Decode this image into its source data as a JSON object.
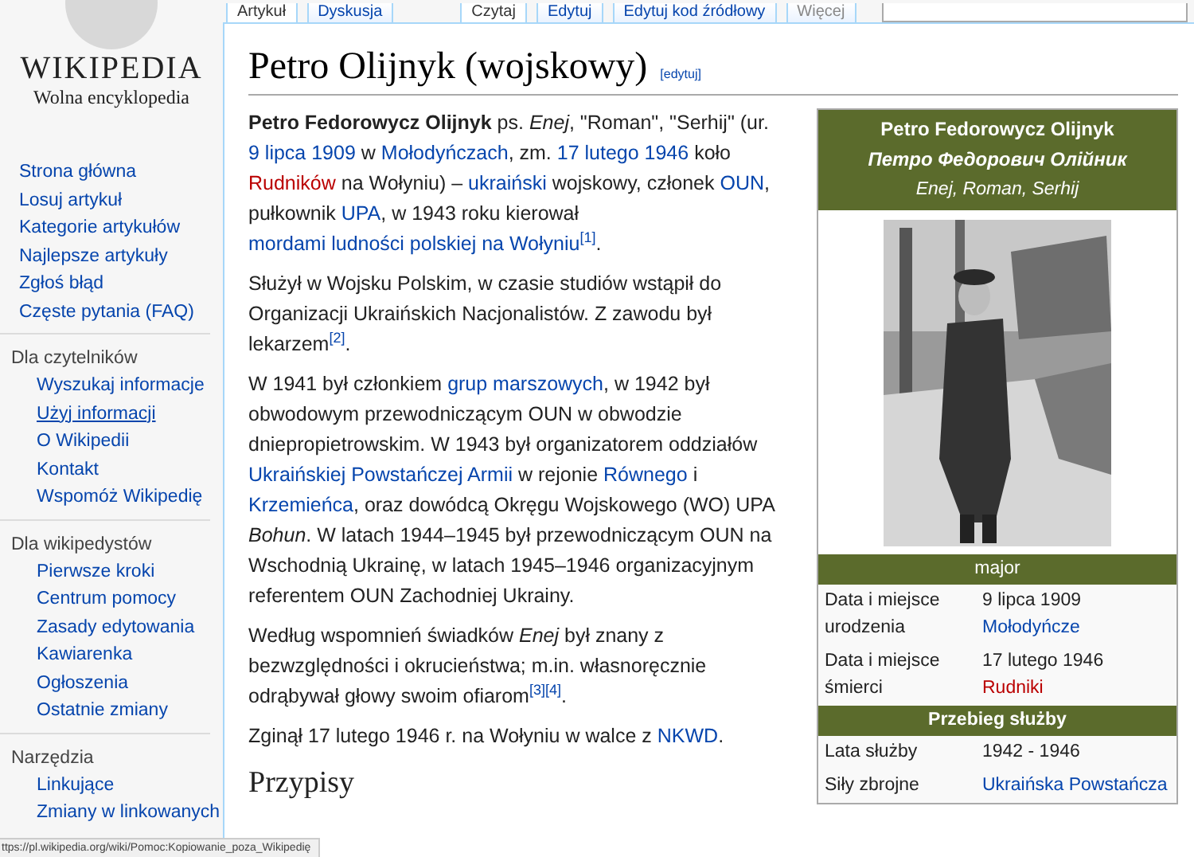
{
  "tabs_left": [
    {
      "label": "Artykuł",
      "selected": true
    },
    {
      "label": "Dyskusja",
      "selected": false
    }
  ],
  "tabs_right": [
    {
      "label": "Czytaj",
      "selected": true
    },
    {
      "label": "Edytuj",
      "selected": false
    },
    {
      "label": "Edytuj kod źródłowy",
      "selected": false
    },
    {
      "label": "Więcej",
      "selected": false
    }
  ],
  "logo": {
    "name": "WIKIPEDIA",
    "tagline": "Wolna encyklopedia"
  },
  "sidebar": [
    {
      "items": [
        {
          "label": "Strona główna",
          "hovered": false
        },
        {
          "label": "Losuj artykuł",
          "hovered": false
        },
        {
          "label": "Kategorie artykułów",
          "hovered": false
        },
        {
          "label": "Najlepsze artykuły",
          "hovered": false
        },
        {
          "label": "Zgłoś błąd",
          "hovered": false
        },
        {
          "label": "Częste pytania (FAQ)",
          "hovered": false
        }
      ]
    },
    {
      "heading": "Dla czytelników",
      "items": [
        {
          "label": "Wyszukaj informacje",
          "hovered": false
        },
        {
          "label": "Użyj informacji",
          "hovered": true
        },
        {
          "label": "O Wikipedii",
          "hovered": false
        },
        {
          "label": "Kontakt",
          "hovered": false
        },
        {
          "label": "Wspomóż Wikipedię",
          "hovered": false
        }
      ]
    },
    {
      "heading": "Dla wikipedystów",
      "items": [
        {
          "label": "Pierwsze kroki",
          "hovered": false
        },
        {
          "label": "Centrum pomocy",
          "hovered": false
        },
        {
          "label": "Zasady edytowania",
          "hovered": false
        },
        {
          "label": "Kawiarenka",
          "hovered": false
        },
        {
          "label": "Ogłoszenia",
          "hovered": false
        },
        {
          "label": "Ostatnie zmiany",
          "hovered": false
        }
      ]
    },
    {
      "heading": "Narzędzia",
      "items": [
        {
          "label": "Linkujące",
          "hovered": false
        },
        {
          "label": "Zmiany w linkowanych",
          "hovered": false
        }
      ]
    }
  ],
  "title": "Petro Olijnyk (wojskowy)",
  "edit_link": "[edytuj]",
  "paragraphs": [
    [
      {
        "kind": "bold",
        "text": "Petro Fedorowycz Olijnyk"
      },
      {
        "kind": "text",
        "text": " ps. "
      },
      {
        "kind": "italic",
        "text": "Enej"
      },
      {
        "kind": "text",
        "text": ", \"Roman\", \"Serhij\" (ur. "
      },
      {
        "kind": "link",
        "text": "9 lipca 1909"
      },
      {
        "kind": "text",
        "text": " w "
      },
      {
        "kind": "link",
        "text": "Mołodyńczach"
      },
      {
        "kind": "text",
        "text": ", zm. "
      },
      {
        "kind": "link",
        "text": "17 lutego 1946"
      },
      {
        "kind": "text",
        "text": " koło "
      },
      {
        "kind": "new",
        "text": "Rudników"
      },
      {
        "kind": "text",
        "text": " na Wołyniu) – "
      },
      {
        "kind": "link",
        "text": "ukraiński"
      },
      {
        "kind": "text",
        "text": " wojskowy, członek "
      },
      {
        "kind": "link",
        "text": "OUN"
      },
      {
        "kind": "text",
        "text": ", pułkownik "
      },
      {
        "kind": "link",
        "text": "UPA"
      },
      {
        "kind": "text",
        "text": ", w 1943 roku kierował "
      },
      {
        "kind": "link",
        "text": "mordami ludności polskiej na Wołyniu"
      },
      {
        "kind": "ref",
        "text": "[1]"
      },
      {
        "kind": "text",
        "text": "."
      }
    ],
    [
      {
        "kind": "text",
        "text": "Służył w Wojsku Polskim, w czasie studiów wstąpił do Organizacji Ukraińskich Nacjonalistów. Z zawodu był lekarzem"
      },
      {
        "kind": "ref",
        "text": "[2]"
      },
      {
        "kind": "text",
        "text": "."
      }
    ],
    [
      {
        "kind": "text",
        "text": "W 1941 był członkiem "
      },
      {
        "kind": "link",
        "text": "grup marszowych"
      },
      {
        "kind": "text",
        "text": ", w 1942 był obwodowym przewodniczącym OUN w obwodzie dniepropietrowskim. W 1943 był organizatorem oddziałów "
      },
      {
        "kind": "link",
        "text": "Ukraińskiej Powstańczej Armii"
      },
      {
        "kind": "text",
        "text": " w rejonie "
      },
      {
        "kind": "link",
        "text": "Równego"
      },
      {
        "kind": "text",
        "text": " i "
      },
      {
        "kind": "link",
        "text": "Krzemieńca"
      },
      {
        "kind": "text",
        "text": ", oraz dowódcą Okręgu Wojskowego (WO) UPA "
      },
      {
        "kind": "italic",
        "text": "Bohun"
      },
      {
        "kind": "text",
        "text": ". W latach 1944–1945 był przewodniczącym OUN na Wschodnią Ukrainę, w latach 1945–1946 organizacyjnym referentem OUN Zachodniej Ukrainy."
      }
    ],
    [
      {
        "kind": "text",
        "text": "Według wspomnień świadków "
      },
      {
        "kind": "italic",
        "text": "Enej"
      },
      {
        "kind": "text",
        "text": " był znany z bezwzględności i okrucieństwa; m.in. własnoręcznie odrąbywał głowy swoim ofiarom"
      },
      {
        "kind": "ref",
        "text": "[3]"
      },
      {
        "kind": "ref",
        "text": "[4]"
      },
      {
        "kind": "text",
        "text": "."
      }
    ],
    [
      {
        "kind": "text",
        "text": "Zginął 17 lutego 1946 r. na Wołyniu w walce z "
      },
      {
        "kind": "link",
        "text": "NKWD"
      },
      {
        "kind": "text",
        "text": "."
      }
    ]
  ],
  "section_heading": "Przypisy",
  "infobox": {
    "name": "Petro Fedorowycz Olijnyk",
    "native_name": "Петро Федорович Олійник",
    "aliases": "Enej, Roman, Serhij",
    "sections": [
      {
        "kind": "header",
        "text": "major"
      },
      {
        "kind": "row",
        "label": "Data i miejsce urodzenia",
        "values": [
          {
            "kind": "text",
            "text": "9 lipca 1909"
          },
          {
            "kind": "link",
            "text": "Mołodyńcze"
          }
        ]
      },
      {
        "kind": "row",
        "label": "Data i miejsce śmierci",
        "values": [
          {
            "kind": "text",
            "text": "17 lutego 1946"
          },
          {
            "kind": "new",
            "text": "Rudniki"
          }
        ]
      },
      {
        "kind": "header",
        "text": "Przebieg służby"
      },
      {
        "kind": "row",
        "label": "Lata służby",
        "values": [
          {
            "kind": "text",
            "text": "1942 - 1946"
          }
        ]
      },
      {
        "kind": "row",
        "label": "Siły zbrojne",
        "values": [
          {
            "kind": "link",
            "text": "Ukraińska Powstańcza"
          }
        ]
      }
    ]
  },
  "status_bar": "ttps://pl.wikipedia.org/wiki/Pomoc:Kopiowanie_poza_Wikipedię"
}
